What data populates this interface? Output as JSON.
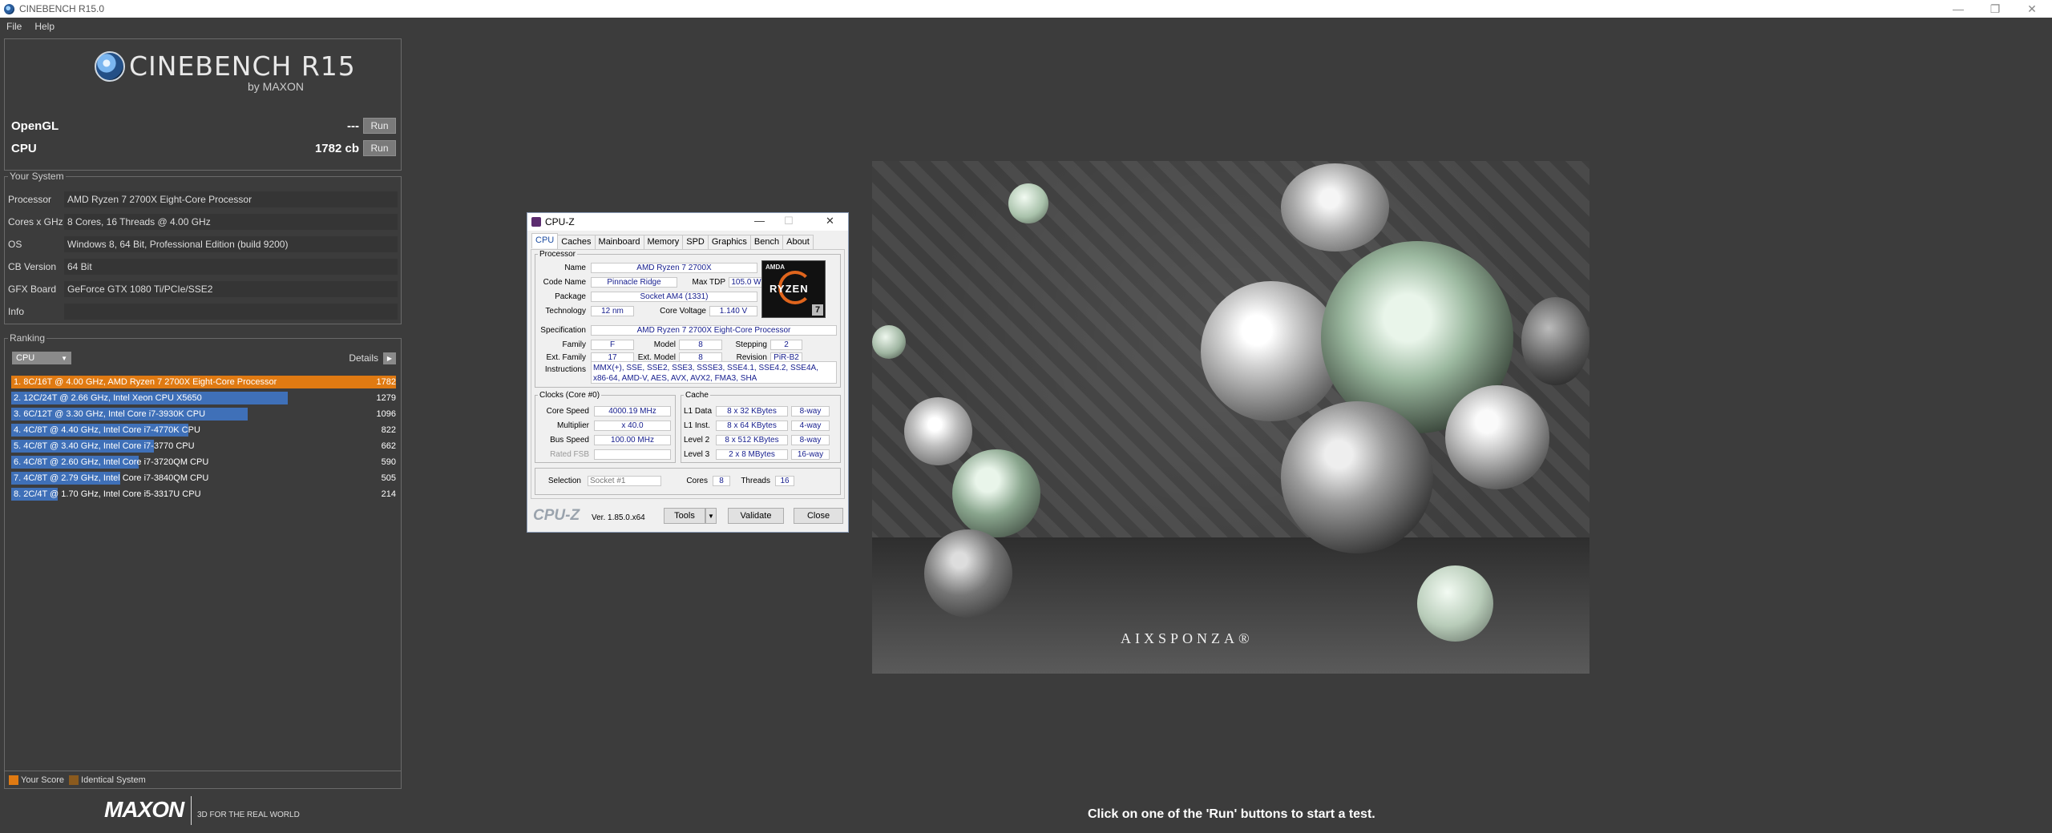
{
  "window": {
    "title": "CINEBENCH R15.0",
    "min": "—",
    "max": "❐",
    "close": "✕"
  },
  "menu": [
    "File",
    "Help"
  ],
  "logo": {
    "name": "CINEBENCH R15",
    "by": "by MAXON"
  },
  "scores": {
    "opengl": {
      "label": "OpenGL",
      "value": "---",
      "run": "Run"
    },
    "cpu": {
      "label": "CPU",
      "value": "1782 cb",
      "run": "Run"
    }
  },
  "system": {
    "title": "Your System",
    "rows": [
      {
        "key": "Processor",
        "value": "AMD Ryzen 7 2700X Eight-Core Processor"
      },
      {
        "key": "Cores x GHz",
        "value": "8 Cores, 16 Threads @ 4.00 GHz"
      },
      {
        "key": "OS",
        "value": "Windows 8, 64 Bit, Professional Edition (build 9200)"
      },
      {
        "key": "CB Version",
        "value": "64 Bit"
      },
      {
        "key": "GFX Board",
        "value": "GeForce GTX 1080 Ti/PCIe/SSE2"
      },
      {
        "key": "Info",
        "value": ""
      }
    ]
  },
  "ranking": {
    "title": "Ranking",
    "selector": "CPU",
    "details": "Details",
    "max_score": 1782,
    "items": [
      {
        "label": "1. 8C/16T @ 4.00 GHz, AMD Ryzen 7 2700X Eight-Core Processor",
        "score": 1782,
        "mine": true
      },
      {
        "label": "2. 12C/24T @ 2.66 GHz, Intel Xeon CPU X5650",
        "score": 1279,
        "mine": false
      },
      {
        "label": "3. 6C/12T @ 3.30 GHz,  Intel Core i7-3930K CPU",
        "score": 1096,
        "mine": false
      },
      {
        "label": "4. 4C/8T @ 4.40 GHz, Intel Core i7-4770K CPU",
        "score": 822,
        "mine": false
      },
      {
        "label": "5. 4C/8T @ 3.40 GHz,  Intel Core i7-3770 CPU",
        "score": 662,
        "mine": false
      },
      {
        "label": "6. 4C/8T @ 2.60 GHz, Intel Core i7-3720QM CPU",
        "score": 590,
        "mine": false
      },
      {
        "label": "7. 4C/8T @ 2.79 GHz, Intel Core i7-3840QM CPU",
        "score": 505,
        "mine": false
      },
      {
        "label": "8. 2C/4T @ 1.70 GHz,  Intel Core i5-3317U CPU",
        "score": 214,
        "mine": false
      }
    ],
    "legend_your": "Your Score",
    "legend_identical": "Identical System",
    "color_your": "#e07a12",
    "color_identical": "#8a5a1e"
  },
  "footer": {
    "brand": "MAXON",
    "tagline": "3D FOR THE REAL WORLD"
  },
  "hint": "Click on one of the 'Run' buttons to start a test.",
  "render": {
    "brand": "AIXSPONZA®"
  },
  "cpuz": {
    "title": "CPU-Z",
    "tabs": [
      "CPU",
      "Caches",
      "Mainboard",
      "Memory",
      "SPD",
      "Graphics",
      "Bench",
      "About"
    ],
    "processor_legend": "Processor",
    "name_label": "Name",
    "name": "AMD Ryzen 7 2700X",
    "codename_label": "Code Name",
    "codename": "Pinnacle Ridge",
    "maxtdp_label": "Max TDP",
    "maxtdp": "105.0 W",
    "package_label": "Package",
    "package": "Socket AM4 (1331)",
    "technology_label": "Technology",
    "technology": "12 nm",
    "voltage_label": "Core Voltage",
    "voltage": "1.140 V",
    "spec_label": "Specification",
    "spec": "AMD Ryzen 7 2700X Eight-Core Processor",
    "family_label": "Family",
    "family": "F",
    "model_label": "Model",
    "model": "8",
    "stepping_label": "Stepping",
    "stepping": "2",
    "extfamily_label": "Ext. Family",
    "extfamily": "17",
    "extmodel_label": "Ext. Model",
    "extmodel": "8",
    "revision_label": "Revision",
    "revision": "PiR-B2",
    "instr_label": "Instructions",
    "instructions": "MMX(+), SSE, SSE2, SSE3, SSSE3, SSE4.1, SSE4.2, SSE4A, x86-64, AMD-V, AES, AVX, AVX2, FMA3, SHA",
    "logo_amd": "AMDA",
    "logo_ryzen": "RYZEN",
    "logo_seven": "7",
    "clocks_legend": "Clocks (Core #0)",
    "corespeed_label": "Core Speed",
    "corespeed": "4000.19 MHz",
    "multiplier_label": "Multiplier",
    "multiplier": "x 40.0",
    "busspeed_label": "Bus Speed",
    "busspeed": "100.00 MHz",
    "ratedfsb_label": "Rated FSB",
    "ratedfsb": "",
    "cache_legend": "Cache",
    "l1d_label": "L1 Data",
    "l1d": "8 x 32 KBytes",
    "l1d_way": "8-way",
    "l1i_label": "L1 Inst.",
    "l1i": "8 x 64 KBytes",
    "l1i_way": "4-way",
    "l2_label": "Level 2",
    "l2": "8 x 512 KBytes",
    "l2_way": "8-way",
    "l3_label": "Level 3",
    "l3": "2 x 8 MBytes",
    "l3_way": "16-way",
    "selection_label": "Selection",
    "selection": "Socket #1",
    "cores_label": "Cores",
    "cores": "8",
    "threads_label": "Threads",
    "threads": "16",
    "brand": "CPU-Z",
    "version": "Ver. 1.85.0.x64",
    "tools": "Tools",
    "validate": "Validate",
    "close": "Close"
  }
}
